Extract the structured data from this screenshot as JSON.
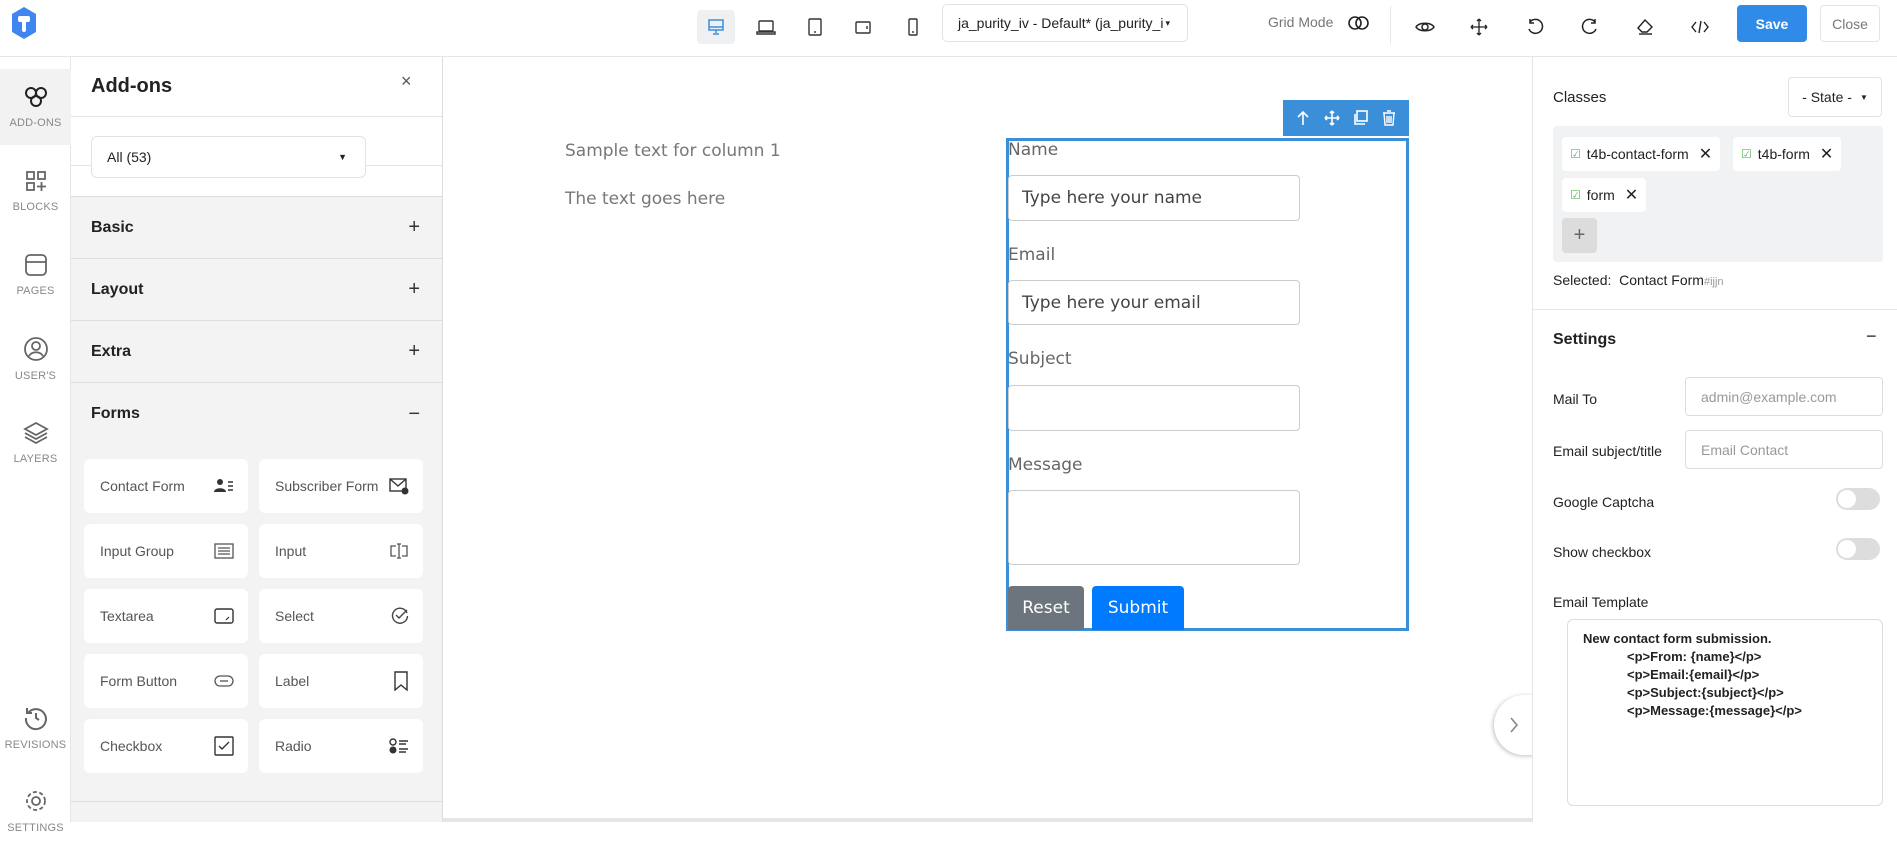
{
  "topbar": {
    "logo_letter": "T",
    "devices": [
      "desktop",
      "laptop",
      "tablet",
      "tablet-landscape",
      "mobile"
    ],
    "template_select": "ja_purity_iv - Default* (ja_purity_i",
    "grid_mode_label": "Grid Mode",
    "save_label": "Save",
    "close_label": "Close"
  },
  "rail": {
    "items": [
      {
        "label": "ADD-ONS"
      },
      {
        "label": "BLOCKS"
      },
      {
        "label": "PAGES"
      },
      {
        "label": "USER'S"
      },
      {
        "label": "LAYERS"
      },
      {
        "label": "REVISIONS"
      },
      {
        "label": "SETTINGS"
      }
    ]
  },
  "addons": {
    "title": "Add-ons",
    "filter": "All (53)",
    "sections": [
      {
        "label": "Basic",
        "toggle": "+"
      },
      {
        "label": "Layout",
        "toggle": "+"
      },
      {
        "label": "Extra",
        "toggle": "+"
      },
      {
        "label": "Forms",
        "toggle": "−"
      }
    ],
    "forms_items": [
      {
        "label": "Contact Form"
      },
      {
        "label": "Subscriber Form"
      },
      {
        "label": "Input Group"
      },
      {
        "label": "Input"
      },
      {
        "label": "Textarea"
      },
      {
        "label": "Select"
      },
      {
        "label": "Form Button"
      },
      {
        "label": "Label"
      },
      {
        "label": "Checkbox"
      },
      {
        "label": "Radio"
      }
    ]
  },
  "canvas": {
    "col1_text1": "Sample text for column 1",
    "col1_text2": "The text goes here",
    "form": {
      "name_label": "Name",
      "name_value": "Type here your name",
      "email_label": "Email",
      "email_value": "Type here your email",
      "subject_label": "Subject",
      "message_label": "Message",
      "reset_label": "Reset",
      "submit_label": "Submit"
    }
  },
  "right": {
    "classes_label": "Classes",
    "state_select": "- State -",
    "classes": [
      "t4b-contact-form",
      "t4b-form",
      "form"
    ],
    "selected_label": "Selected:",
    "selected_name": "Contact Form",
    "selected_id": "#ijjn",
    "settings_title": "Settings",
    "mail_to_label": "Mail To",
    "mail_to_placeholder": "admin@example.com",
    "subject_label": "Email subject/title",
    "subject_placeholder": "Email Contact",
    "captcha_label": "Google Captcha",
    "captcha_on": false,
    "checkbox_label": "Show checkbox",
    "checkbox_on": false,
    "template_label": "Email Template",
    "template_lines": [
      "New contact form submission.",
      "<p>From: {name}</p>",
      "<p>Email:{email}</p>",
      "<p>Subject:{subject}</p>",
      "<p>Message:{message}</p>"
    ]
  },
  "colors": {
    "accent": "#2f8ae8",
    "selection": "#3b8fd9",
    "reset": "#6c757d",
    "submit": "#007bff"
  }
}
